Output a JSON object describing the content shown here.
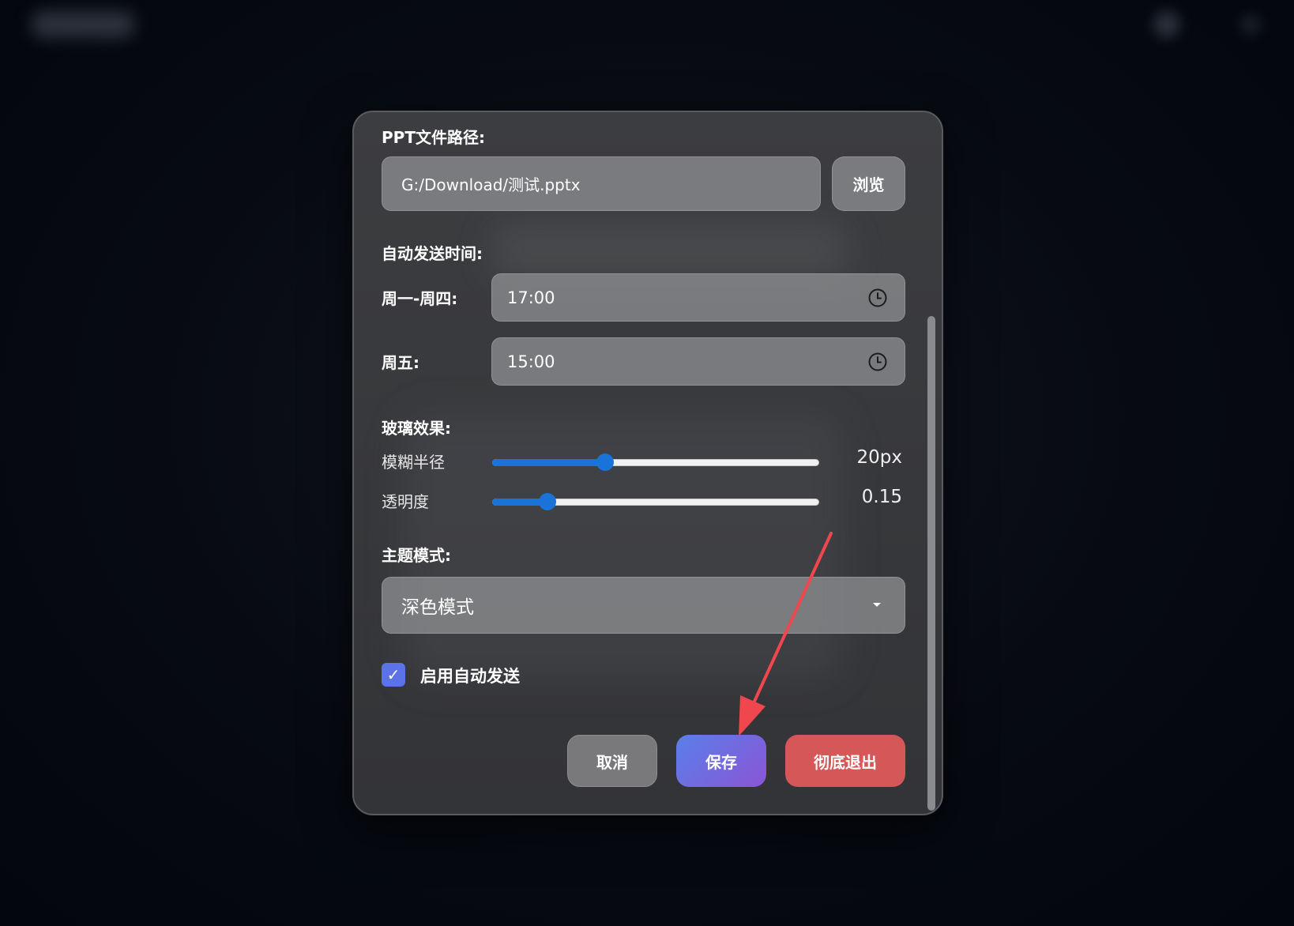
{
  "dialog": {
    "ppt_path": {
      "label": "PPT文件路径:",
      "value": "G:/Download/测试.pptx",
      "browse_label": "浏览"
    },
    "auto_send": {
      "label": "自动发送时间:",
      "mon_thu": {
        "label": "周一-周四:",
        "value": "17:00"
      },
      "fri": {
        "label": "周五:",
        "value": "15:00"
      }
    },
    "glass": {
      "label": "玻璃效果:",
      "blur": {
        "label": "模糊半径",
        "value_text": "20px",
        "fraction": 0.345
      },
      "opacity": {
        "label": "透明度",
        "value_text": "0.15",
        "fraction": 0.17
      }
    },
    "theme": {
      "label": "主题模式:",
      "selected": "深色模式"
    },
    "enable_auto": {
      "checked": true,
      "check_mark": "✓",
      "label": "启用自动发送"
    },
    "buttons": {
      "cancel": "取消",
      "save": "保存",
      "exit": "彻底退出"
    }
  },
  "colors": {
    "accent_blue": "#1a73d9",
    "save_gradient_start": "#5a7fe8",
    "save_gradient_end": "#8a55d6",
    "exit_red": "#d65757",
    "annotation_arrow": "#f0474f"
  },
  "icons": {
    "time_picker": "clock-icon",
    "dropdown": "caret-down-icon",
    "checkbox": "checkmark-icon"
  }
}
